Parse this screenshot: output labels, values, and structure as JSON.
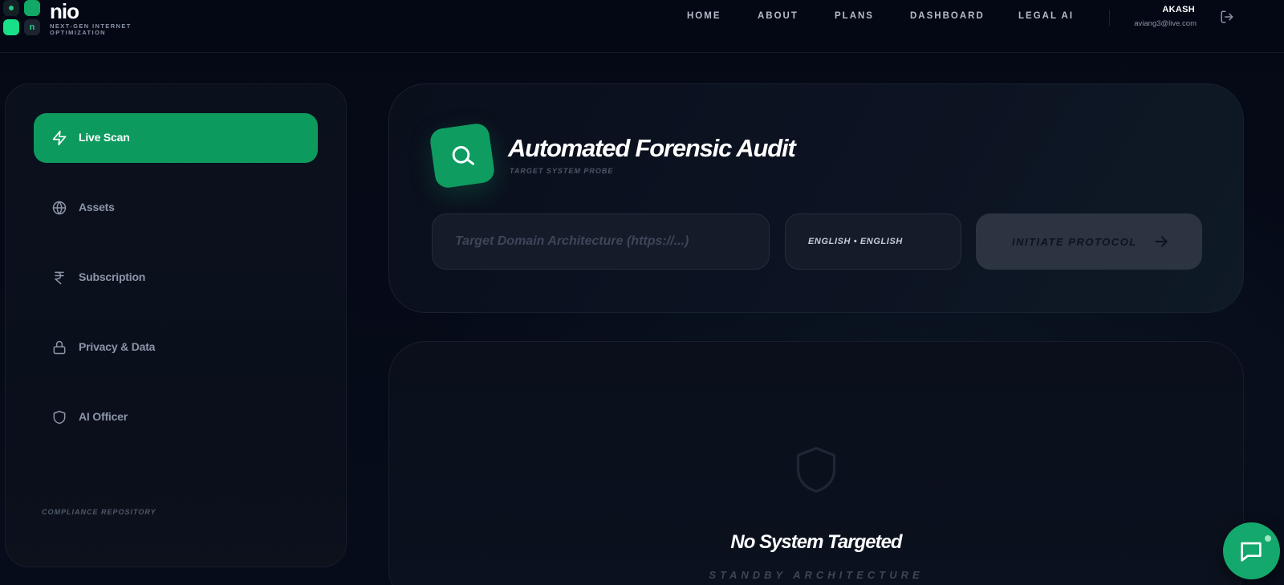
{
  "brand": {
    "name": "nio",
    "logo_letter": "n",
    "tagline": "NEXT-GEN INTERNET OPTIMIZATION"
  },
  "nav": {
    "items": [
      "HOME",
      "ABOUT",
      "PLANS",
      "DASHBOARD",
      "LEGAL AI"
    ]
  },
  "user": {
    "name": "AKASH",
    "email": "aviang3@live.com"
  },
  "sidebar": {
    "items": [
      {
        "label": "Live Scan",
        "icon": "bolt-icon",
        "active": true
      },
      {
        "label": "Assets",
        "icon": "globe-icon",
        "active": false
      },
      {
        "label": "Subscription",
        "icon": "rupee-icon",
        "active": false
      },
      {
        "label": "Privacy & Data",
        "icon": "lock-icon",
        "active": false
      },
      {
        "label": "AI Officer",
        "icon": "shield-icon",
        "active": false
      }
    ],
    "footer_label": "COMPLIANCE REPOSITORY"
  },
  "audit": {
    "title": "Automated Forensic Audit",
    "subtitle": "TARGET SYSTEM PROBE",
    "domain_input": {
      "value": "",
      "placeholder": "Target Domain Architecture (https://...)"
    },
    "language": "ENGLISH • ENGLISH",
    "submit_label": "INITIATE PROTOCOL"
  },
  "results": {
    "title": "No System Targeted",
    "subtitle": "STANDBY ARCHITECTURE"
  },
  "colors": {
    "accent": "#0d9a5f",
    "background": "#060b18",
    "panel": "#0b101d",
    "muted_text": "#8c95a8"
  }
}
